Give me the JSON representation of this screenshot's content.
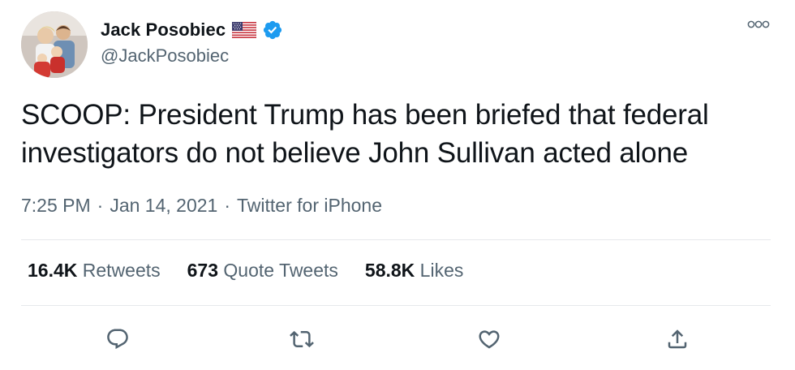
{
  "author": {
    "display_name": "Jack Posobiec",
    "handle": "@JackPosobiec",
    "flag_icon": "us-flag-icon",
    "verified_icon": "verified-badge-icon"
  },
  "tweet": {
    "text": "SCOOP: President Trump has been briefed that federal investigators do not believe John Sullivan acted alone",
    "time": "7:25 PM",
    "date": "Jan 14, 2021",
    "source": "Twitter for iPhone",
    "separator": "·"
  },
  "stats": {
    "retweets_count": "16.4K",
    "retweets_label": "Retweets",
    "quotes_count": "673",
    "quotes_label": "Quote Tweets",
    "likes_count": "58.8K",
    "likes_label": "Likes"
  },
  "actions": [
    "reply-icon",
    "retweet-icon",
    "like-icon",
    "share-icon"
  ],
  "colors": {
    "text": "#0f1419",
    "secondary": "#536471",
    "verified": "#1d9bf0",
    "divider": "#e6e9eb"
  }
}
